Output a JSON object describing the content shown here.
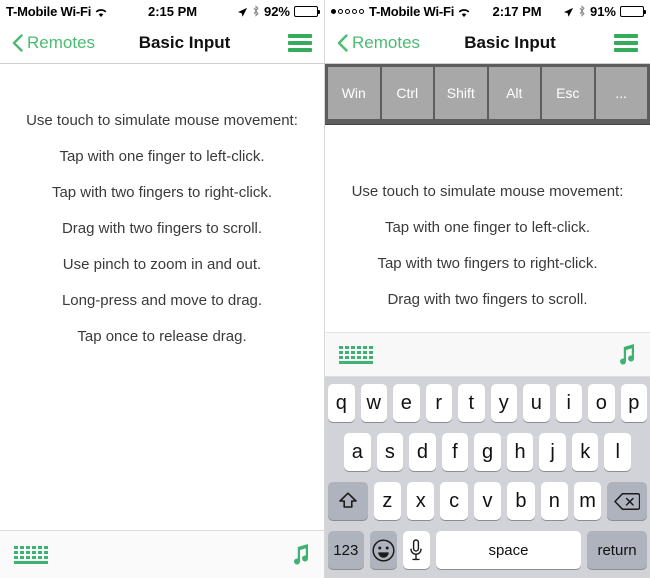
{
  "left_panel": {
    "status_bar": {
      "carrier": "T-Mobile Wi-Fi",
      "wifi_icon": "wifi-icon",
      "time": "2:15 PM",
      "location_icon": "location-arrow-icon",
      "bluetooth_icon": "bluetooth-icon",
      "battery_percent": "92%",
      "battery_icon": "battery-icon",
      "signal_dots_filled": 0,
      "signal_dots_total": 0
    },
    "nav_bar": {
      "back_icon": "chevron-left-icon",
      "back_label": "Remotes",
      "title": "Basic Input",
      "menu_icon": "hamburger-menu-icon"
    },
    "instructions": [
      "Use touch to simulate mouse movement:",
      "Tap with one finger to left-click.",
      "Tap with two fingers to right-click.",
      "Drag with two fingers to scroll.",
      "Use pinch to zoom in and out.",
      "Long-press and move to drag.",
      "Tap once to release drag."
    ],
    "bottom_bar": {
      "keyboard_icon": "keyboard-icon",
      "media_icon": "music-note-icon"
    }
  },
  "right_panel": {
    "status_bar": {
      "signal_dots_filled": 1,
      "signal_dots_total": 5,
      "carrier": "T-Mobile Wi-Fi",
      "wifi_icon": "wifi-icon",
      "time": "2:17 PM",
      "location_icon": "location-arrow-icon",
      "bluetooth_icon": "bluetooth-icon",
      "battery_percent": "91%",
      "battery_icon": "battery-icon"
    },
    "nav_bar": {
      "back_icon": "chevron-left-icon",
      "back_label": "Remotes",
      "title": "Basic Input",
      "menu_icon": "hamburger-menu-icon"
    },
    "modifier_keys": [
      "Win",
      "Ctrl",
      "Shift",
      "Alt",
      "Esc",
      "..."
    ],
    "instructions": [
      "Use touch to simulate mouse movement:",
      "Tap with one finger to left-click.",
      "Tap with two fingers to right-click.",
      "Drag with two fingers to scroll."
    ],
    "keyboard_toolbar": {
      "keyboard_icon": "keyboard-icon",
      "media_icon": "music-note-icon"
    },
    "keyboard": {
      "row1": [
        "q",
        "w",
        "e",
        "r",
        "t",
        "y",
        "u",
        "i",
        "o",
        "p"
      ],
      "row2": [
        "a",
        "s",
        "d",
        "f",
        "g",
        "h",
        "j",
        "k",
        "l"
      ],
      "row3": [
        "z",
        "x",
        "c",
        "v",
        "b",
        "n",
        "m"
      ],
      "shift_icon": "shift-arrow-icon",
      "delete_icon": "backspace-delete-icon",
      "numbers_label": "123",
      "emoji_icon": "smiley-emoji-icon",
      "mic_icon": "microphone-icon",
      "space_label": "space",
      "return_label": "return"
    }
  },
  "colors": {
    "accent_green": "#3cb371",
    "nav_green": "#4cbb72",
    "keyboard_bg": "#d1d3d8",
    "key_gray": "#aeb3bd",
    "modkey_gray": "#a8a8a8",
    "modrow_bg": "#5d5d5d"
  }
}
